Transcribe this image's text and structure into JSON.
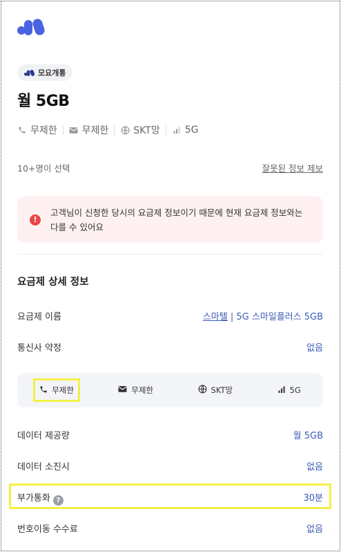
{
  "badge": {
    "label": "모요개통"
  },
  "plan": {
    "title": "월 5GB"
  },
  "specs": [
    {
      "icon": "phone-icon",
      "label": "무제한"
    },
    {
      "icon": "mail-icon",
      "label": "무제한"
    },
    {
      "icon": "globe-icon",
      "label": "SKT망"
    },
    {
      "icon": "signal-icon",
      "label": "5G"
    }
  ],
  "selection": {
    "count_label": "10+명이 선택",
    "report_label": "잘못된 정보 제보"
  },
  "alert": {
    "text": "고객님이 신청한 당시의 요금제 정보이기 때문에 현재 요금제 정보와는 다를 수 있어요"
  },
  "details": {
    "section_title": "요금제 상세 정보",
    "plan_name_label": "요금제 이름",
    "plan_name_brand": "스마텔",
    "plan_name_value": " | 5G 스마일플러스 5GB",
    "contract_label": "통신사 약정",
    "contract_value": "없음",
    "chips": [
      {
        "icon": "phone-icon",
        "label": "무제한"
      },
      {
        "icon": "mail-icon",
        "label": "무제한"
      },
      {
        "icon": "globe-icon",
        "label": "SKT망"
      },
      {
        "icon": "signal-icon",
        "label": "5G"
      }
    ],
    "data_label": "데이터 제공량",
    "data_value": "월 5GB",
    "exhausted_label": "데이터 소진시",
    "exhausted_value": "없음",
    "extra_call_label": "부가통화",
    "extra_call_value": "30분",
    "port_fee_label": "번호이동 수수료",
    "port_fee_value": "없음"
  },
  "colors": {
    "accent": "#3a5bb8",
    "logo": "#4a63e0",
    "alert_bg": "#fff1f1",
    "alert_icon": "#e8474a",
    "highlight": "#f4f048"
  }
}
